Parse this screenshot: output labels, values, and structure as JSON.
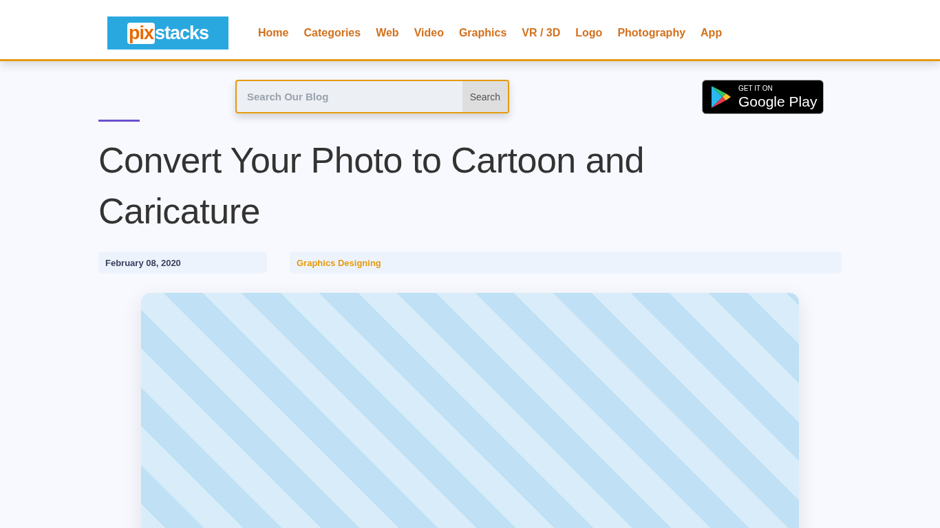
{
  "header": {
    "logo": {
      "part_1": "pix",
      "part_2": "stacks"
    },
    "nav": [
      {
        "label": "Home"
      },
      {
        "label": "Categories"
      },
      {
        "label": "Web"
      },
      {
        "label": "Video"
      },
      {
        "label": "Graphics"
      },
      {
        "label": "VR / 3D"
      },
      {
        "label": "Logo"
      },
      {
        "label": "Photography"
      },
      {
        "label": "App"
      }
    ]
  },
  "search": {
    "placeholder": "Search Our Blog",
    "button": "Search"
  },
  "store_badge": {
    "line_1": "GET IT ON",
    "line_2": "Google Play"
  },
  "article": {
    "title": "Convert Your Photo to Cartoon and Caricature",
    "date": "February 08, 2020",
    "category": "Graphics Designing"
  }
}
